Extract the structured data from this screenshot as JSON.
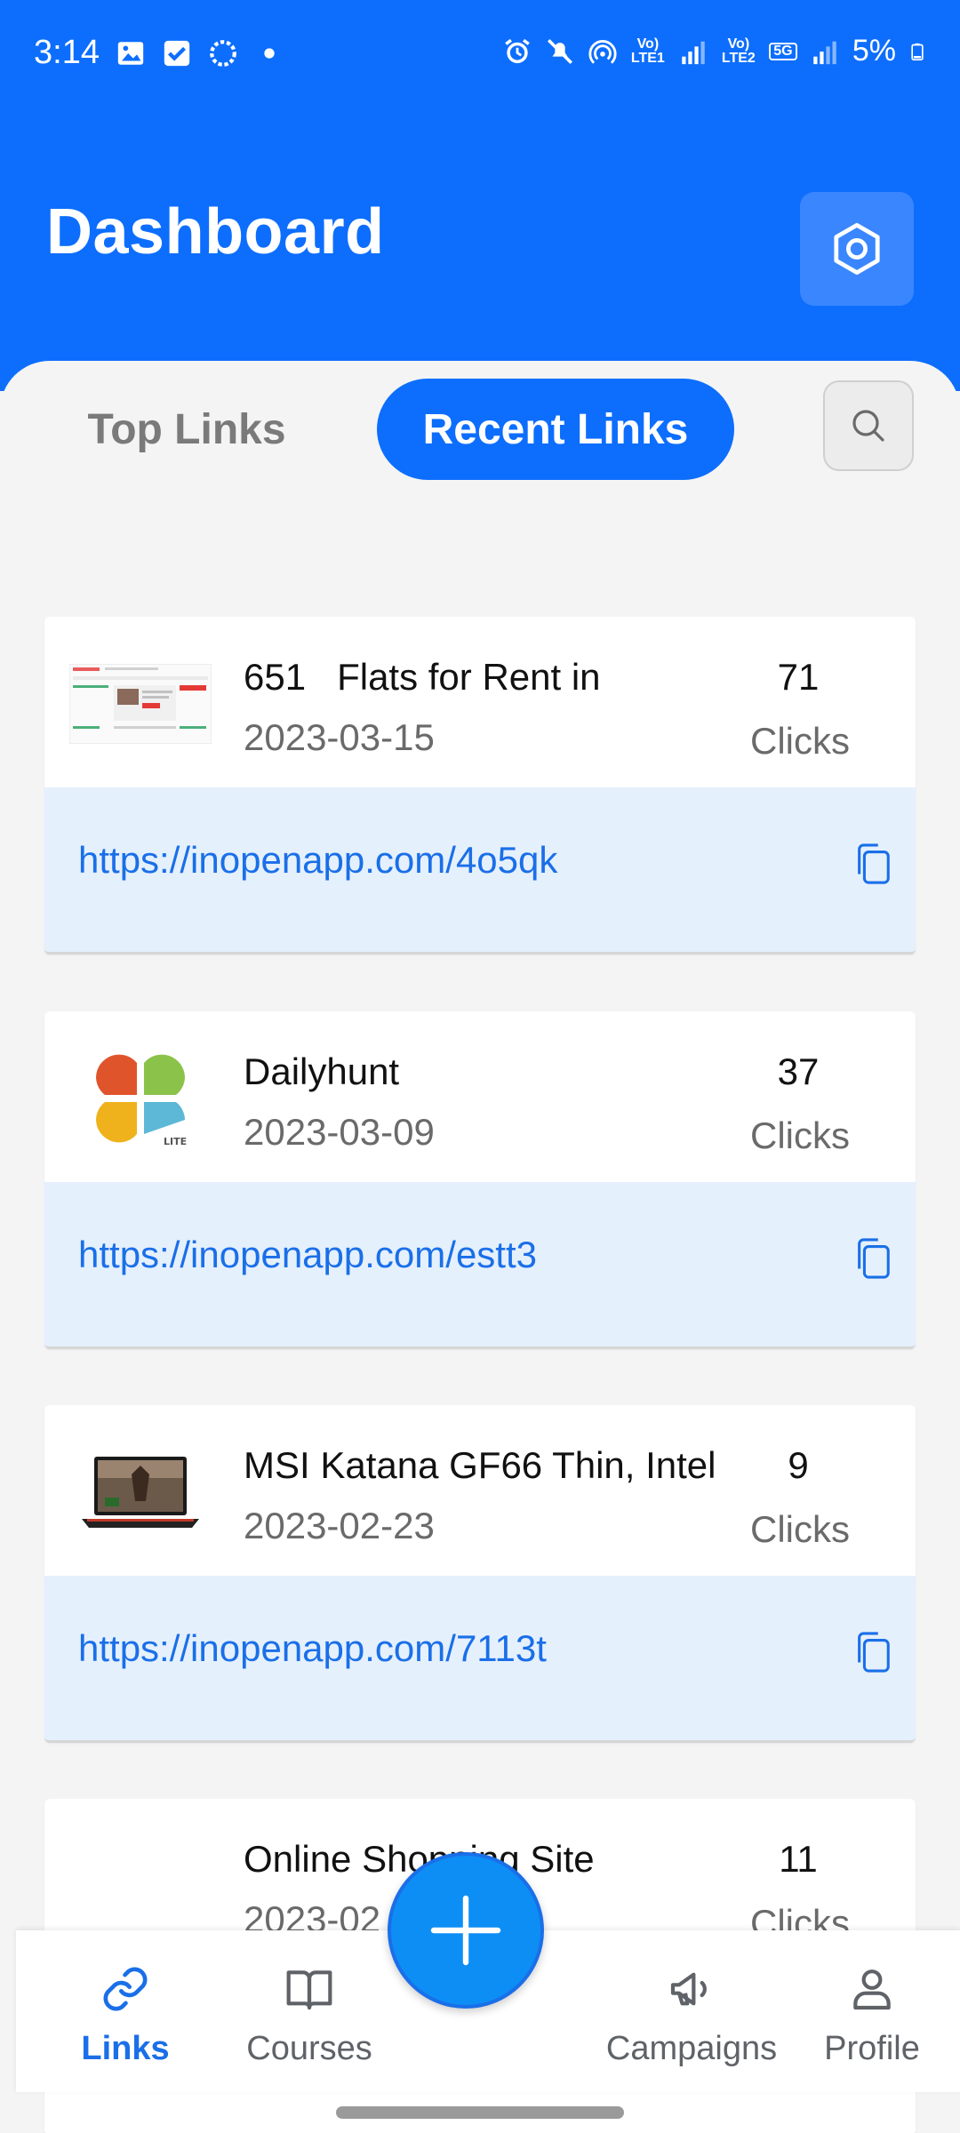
{
  "status_bar": {
    "time": "3:14",
    "battery": "5%",
    "network_label_1": "Vo) LTE1",
    "network_label_2": "Vo) LTE2",
    "network_5g": "5G"
  },
  "header": {
    "title": "Dashboard",
    "settings_icon": "settings-hexagon-icon"
  },
  "tabs": {
    "top_links": "Top Links",
    "recent_links": "Recent Links",
    "active": "recent_links"
  },
  "links": [
    {
      "title": "651   Flats for Rent in",
      "date": "2023-03-15",
      "count": "71",
      "clicks_label": "Clicks",
      "url": "https://inopenapp.com/4o5qk",
      "thumbnail": "webpage-screenshot"
    },
    {
      "title": "Dailyhunt",
      "date": "2023-03-09",
      "count": "37",
      "clicks_label": "Clicks",
      "url": "https://inopenapp.com/estt3",
      "thumbnail": "dailyhunt-logo",
      "thumbnail_badge": "LITE"
    },
    {
      "title": "MSI Katana GF66 Thin, Intel",
      "date": "2023-02-23",
      "count": "9",
      "clicks_label": "Clicks",
      "url": "https://inopenapp.com/7113t",
      "thumbnail": "laptop-image"
    },
    {
      "title": "Online Shopping Site",
      "date": "2023-02",
      "count": "11",
      "clicks_label": "Clicks",
      "url": "",
      "thumbnail": ""
    }
  ],
  "bottom_nav": {
    "links": "Links",
    "courses": "Courses",
    "campaigns": "Campaigns",
    "profile": "Profile",
    "active": "links"
  },
  "colors": {
    "primary": "#0d6efd",
    "link_bg": "#e5f0fd",
    "link_text": "#1a6fe8",
    "fab": "#0d8ef5"
  }
}
